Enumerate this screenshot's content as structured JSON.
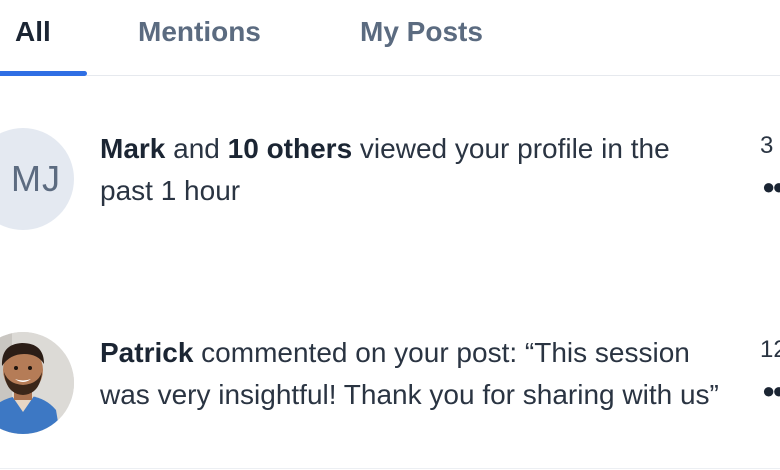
{
  "tabs": {
    "all": "All",
    "mentions": "Mentions",
    "my_posts": "My Posts",
    "active": "All",
    "accent_color": "#2f6fe4"
  },
  "notifications": [
    {
      "avatar_initials": "MJ",
      "actor": "Mark",
      "connector": " and ",
      "others": "10 others",
      "message": " viewed your profile in the past 1 hour",
      "time": "3",
      "more_icon": "more-dots-icon"
    },
    {
      "avatar_type": "photo",
      "actor": "Patrick",
      "message": " commented on your post: “This session was very insightful! Thank you for sharing with us”",
      "time": "12",
      "more_icon": "more-dots-icon"
    }
  ]
}
